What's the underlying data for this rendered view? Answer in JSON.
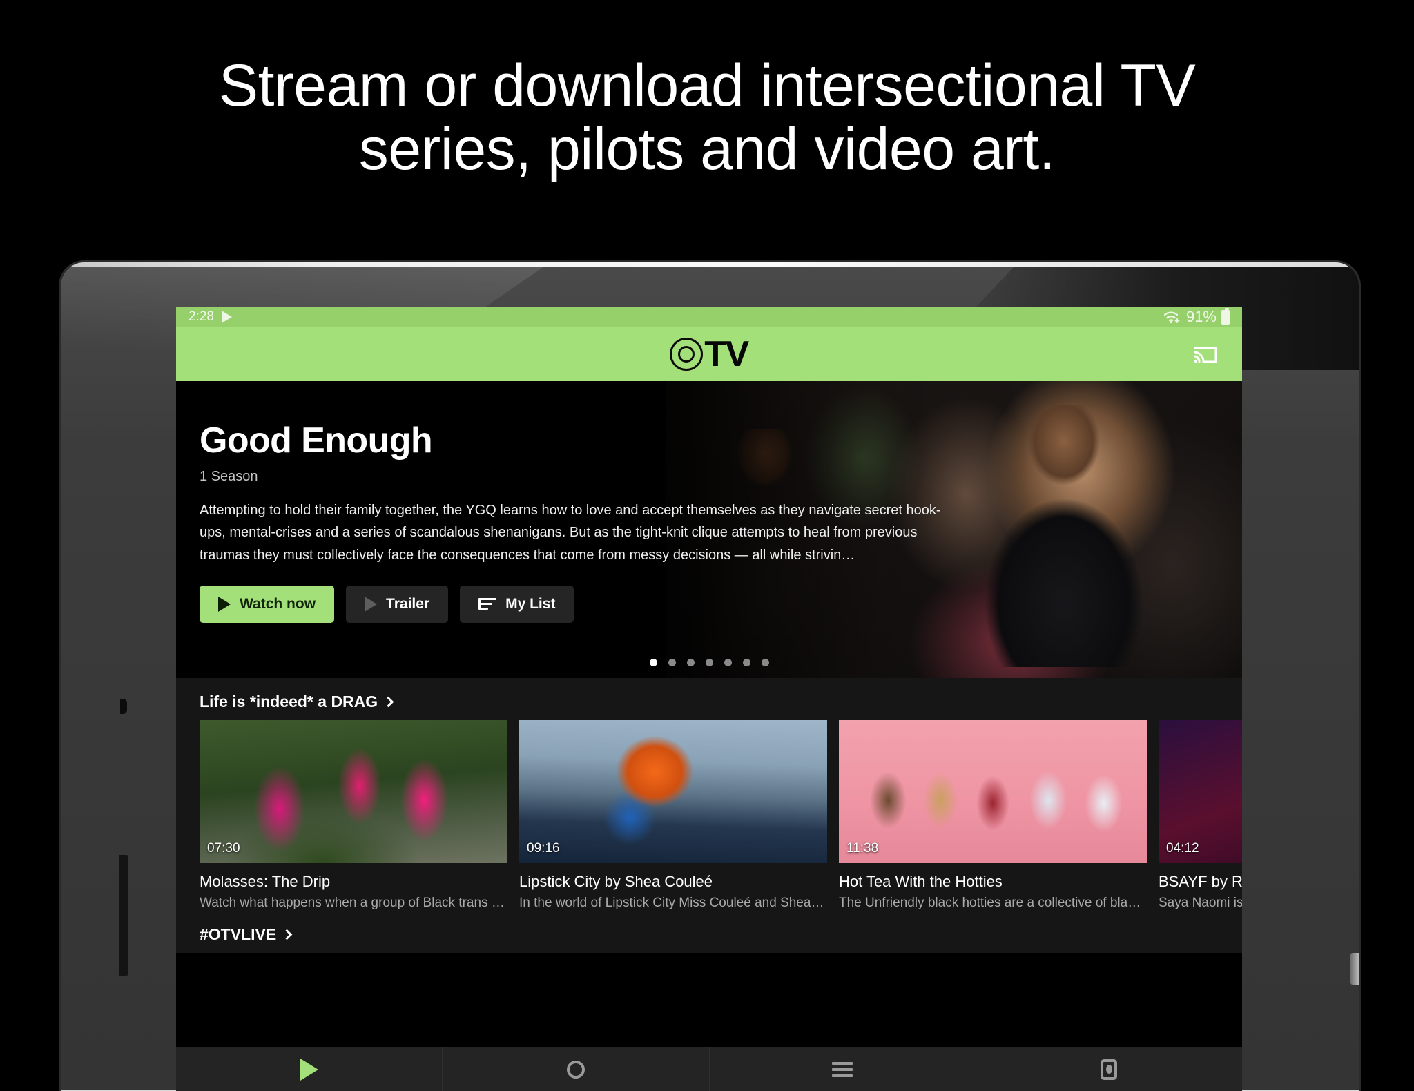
{
  "promo": {
    "headline_line1": "Stream or download intersectional TV",
    "headline_line2": "series, pilots and video art."
  },
  "status_bar": {
    "time": "2:28",
    "play_icon": "play-icon",
    "wifi_icon": "wifi-icon",
    "battery_percent": "91%",
    "battery_icon": "battery-icon"
  },
  "app_bar": {
    "logo_text": "TV",
    "logo_mark_icon": "concentric-circle-logo-icon",
    "cast_icon": "cast-icon",
    "background_color": "#a4e07a"
  },
  "hero": {
    "title": "Good Enough",
    "seasons": "1 Season",
    "description": "Attempting to hold their family together, the YGQ learns how to love and accept themselves as they navigate secret hook-ups, mental-crises and a series of scandalous shenanigans. But as the tight-knit clique attempts to heal from previous traumas they must collectively face the consequences that come from messy decisions — all while strivin…",
    "buttons": [
      {
        "label": "Watch now",
        "icon": "play-icon",
        "style": "primary"
      },
      {
        "label": "Trailer",
        "icon": "play-icon",
        "style": "secondary"
      },
      {
        "label": "My List",
        "icon": "list-plus-icon",
        "style": "secondary"
      }
    ],
    "carousel": {
      "total_dots": 7,
      "active_index": 0
    }
  },
  "rows": [
    {
      "title": "Life is *indeed* a DRAG",
      "chevron_icon": "chevron-right-icon",
      "cards": [
        {
          "duration": "07:30",
          "title": "Molasses: The Drip",
          "subtitle": "Watch what happens when a group of Black trans and…",
          "art": "t1"
        },
        {
          "duration": "09:16",
          "title": "Lipstick City by Shea Couleé",
          "subtitle": "In the world of Lipstick City Miss Couleé and Shea ex…",
          "art": "t2"
        },
        {
          "duration": "11:38",
          "title": "Hot Tea With the Hotties",
          "subtitle": "The Unfriendly black hotties are a collective of black …",
          "art": "t3"
        },
        {
          "duration": "04:12",
          "title": "BSAYF by Ro",
          "subtitle": "Saya Naomi is",
          "art": "t4"
        }
      ]
    },
    {
      "title": "#OTVLIVE",
      "chevron_icon": "chevron-right-icon",
      "cards": []
    }
  ],
  "bottom_nav": [
    {
      "icon": "home-play-icon",
      "active": true
    },
    {
      "icon": "search-icon",
      "active": false
    },
    {
      "icon": "list-icon",
      "active": false
    },
    {
      "icon": "account-icon",
      "active": false
    }
  ],
  "colors": {
    "brand_green": "#a4e07a",
    "status_bar_green": "#96d06a",
    "app_background": "#161616",
    "card_text": "#ffffff",
    "card_subtext": "#a9a9a9"
  }
}
